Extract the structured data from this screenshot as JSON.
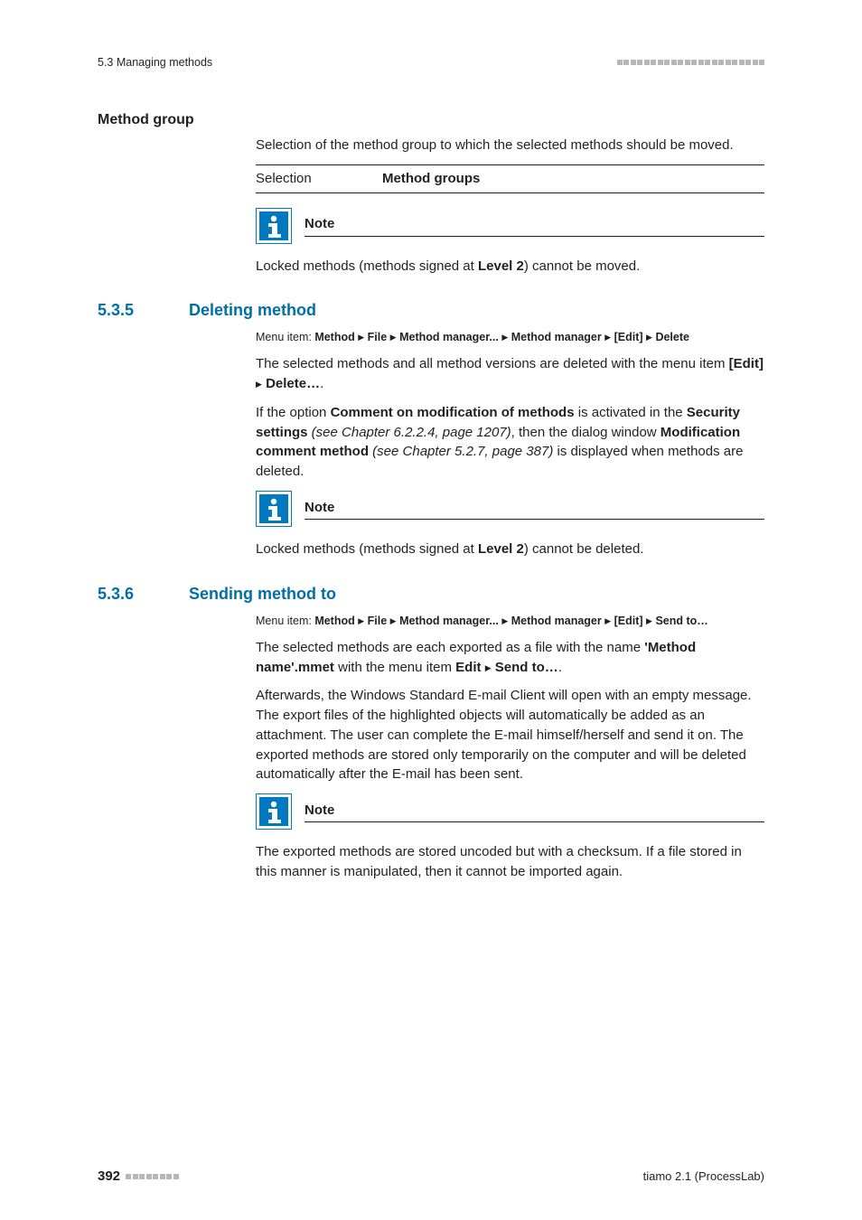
{
  "header": {
    "left": "5.3 Managing methods"
  },
  "method_group": {
    "title": "Method group",
    "intro": "Selection of the method group to which the selected methods should be moved.",
    "sel_label": "Selection",
    "sel_value": "Method groups",
    "note_label": "Note",
    "note_pre": "Locked methods (methods signed at ",
    "note_bold": "Level 2",
    "note_post": ") cannot be moved."
  },
  "sect535": {
    "num": "5.3.5",
    "title": "Deleting method",
    "menu_intro": "Menu item: ",
    "menu_parts": [
      "Method",
      "File",
      "Method manager...",
      "Method manager",
      "[Edit]",
      "Delete"
    ],
    "p1_pre": "The selected methods and all method versions are deleted with the menu item ",
    "p1_b1": "[Edit]",
    "p1_b2": "Delete…",
    "p2_pre": "If the option ",
    "p2_b1": "Comment on modification of methods",
    "p2_mid1": " is activated in the ",
    "p2_b2": "Security settings",
    "p2_it1": " (see Chapter 6.2.2.4, page 1207)",
    "p2_mid2": ", then the dialog window ",
    "p2_b3": "Modification comment method",
    "p2_it2": " (see Chapter 5.2.7, page 387)",
    "p2_post": " is displayed when methods are deleted.",
    "note_label": "Note",
    "note_pre": "Locked methods (methods signed at ",
    "note_bold": "Level 2",
    "note_post": ") cannot be deleted."
  },
  "sect536": {
    "num": "5.3.6",
    "title": "Sending method to",
    "menu_intro": "Menu item: ",
    "menu_parts": [
      "Method",
      "File",
      "Method manager...",
      "Method manager",
      "[Edit]",
      "Send to…"
    ],
    "p1_pre": "The selected methods are each exported as a file with the name ",
    "p1_b1": "'Method name'.mmet",
    "p1_mid": " with the menu item ",
    "p1_b2": "Edit",
    "p1_b3": "Send to…",
    "p2": "Afterwards, the Windows Standard E-mail Client will open with an empty message. The export files of the highlighted objects will automatically be added as an attachment. The user can complete the E-mail himself/herself and send it on. The exported methods are stored only temporarily on the computer and will be deleted automatically after the E-mail has been sent.",
    "note_label": "Note",
    "note_body": "The exported methods are stored uncoded but with a checksum. If a file stored in this manner is manipulated, then it cannot be imported again."
  },
  "footer": {
    "page": "392",
    "right": "tiamo 2.1 (ProcessLab)"
  }
}
